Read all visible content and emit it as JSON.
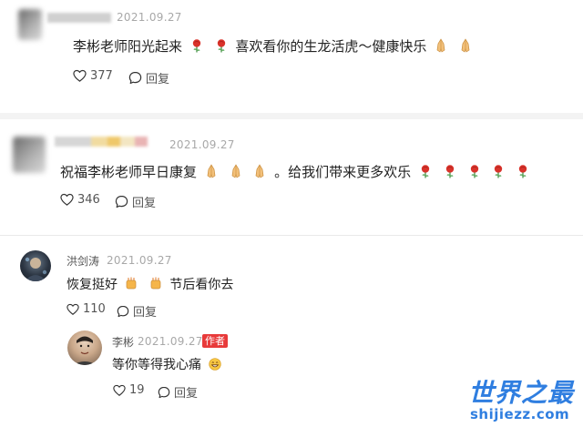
{
  "comments": [
    {
      "date": "2021.09.27",
      "text_before": "李彬老师阳光起来",
      "text_middle": "喜欢看你的生龙活虎～健康快乐",
      "likes": "377",
      "reply_label": "回复"
    },
    {
      "date": "2021.09.27",
      "text_before": "祝福李彬老师早日康复",
      "text_middle": "。给我们带来更多欢乐",
      "likes": "346",
      "reply_label": "回复"
    }
  ],
  "replies": [
    {
      "name": "洪剑涛",
      "date": "2021.09.27",
      "text_before": "恢复挺好",
      "text_after": "节后看你去",
      "likes": "110",
      "reply_label": "回复"
    },
    {
      "name": "李彬",
      "date": "2021.09.27",
      "author_tag": "作者",
      "text": "等你等得我心痛",
      "likes": "19",
      "reply_label": "回复"
    }
  ],
  "watermark": {
    "title": "世界之最",
    "url": "shijiezz.com"
  },
  "colors": {
    "author_tag": "#e83a3a",
    "watermark": "#2f7ee0",
    "rose": "#d9332b",
    "muted": "#a8a8a8"
  },
  "icons": [
    "heart-icon",
    "comment-icon",
    "rose-emoji",
    "praying-hands-emoji",
    "clapping-hands-emoji",
    "grin-emoji"
  ]
}
